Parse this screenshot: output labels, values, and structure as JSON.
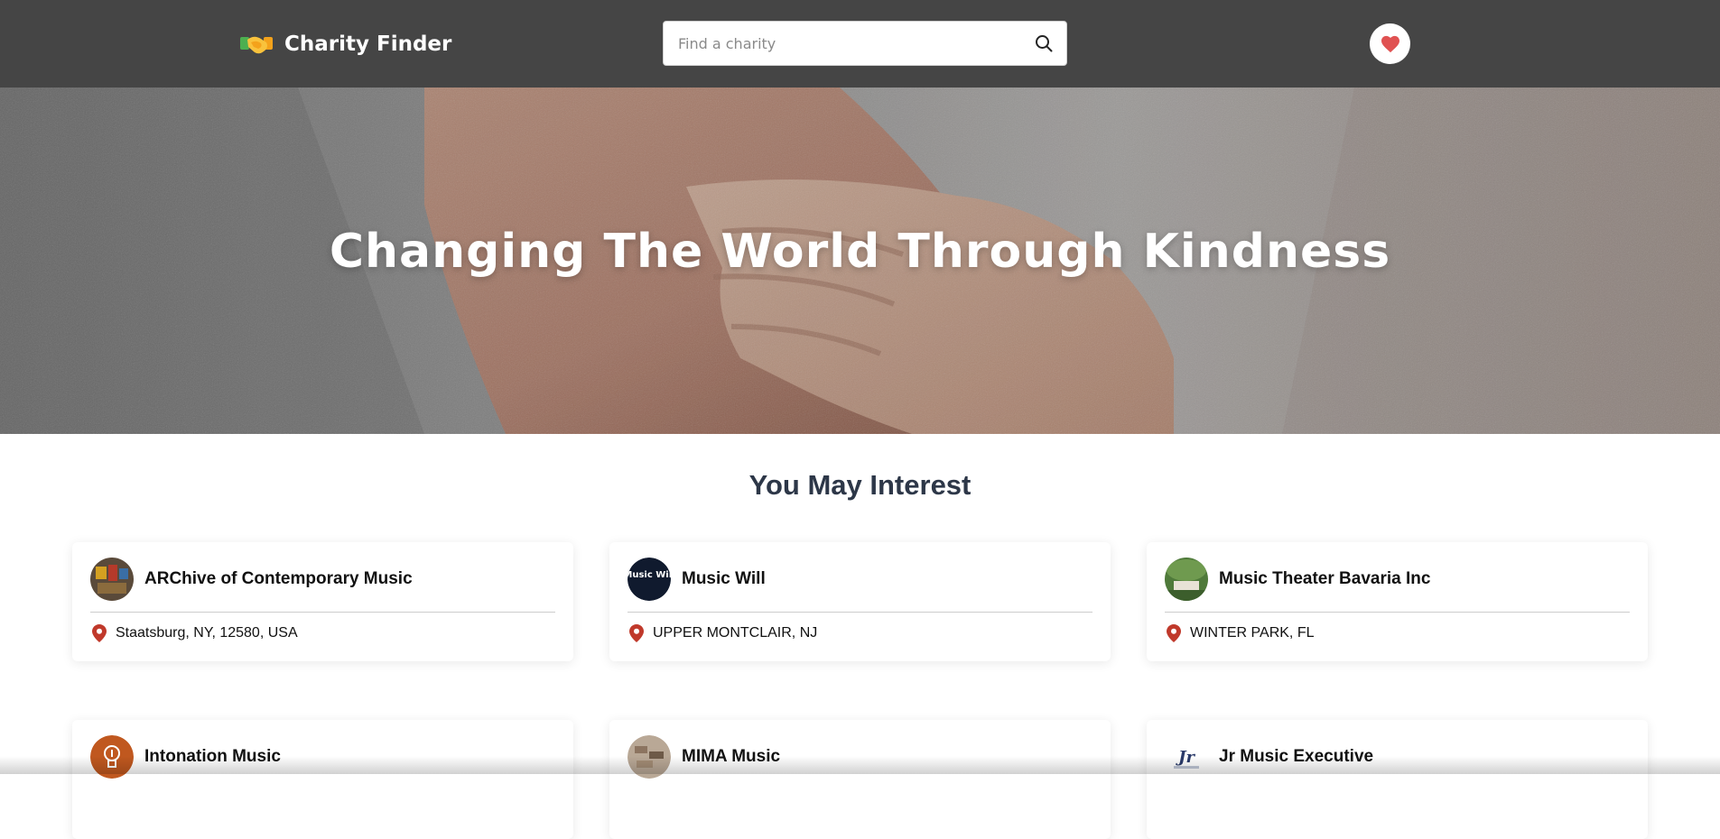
{
  "header": {
    "brand_name": "Charity Finder",
    "logo_icon": "handshake-icon",
    "search": {
      "placeholder": "Find a charity",
      "value": "",
      "icon": "search-icon"
    },
    "favorites_icon": "heart-icon"
  },
  "hero": {
    "title": "Changing The World Through Kindness"
  },
  "section": {
    "title": "You May Interest"
  },
  "charities": [
    {
      "name": "ARChive of Contemporary Music",
      "location": "Staatsburg, NY, 12580, USA",
      "icon": "pin-icon"
    },
    {
      "name": "Music Will",
      "location": "UPPER MONTCLAIR, NJ",
      "icon": "pin-icon"
    },
    {
      "name": "Music Theater Bavaria Inc",
      "location": "WINTER PARK, FL",
      "icon": "pin-icon"
    },
    {
      "name": "Intonation Music"
    },
    {
      "name": "MIMA Music"
    },
    {
      "name": "Jr Music Executive"
    }
  ],
  "logo_texts": {
    "music_will": "Music Will",
    "jr": "Jr"
  },
  "colors": {
    "header_bg": "#454545",
    "heart": "#e05252",
    "pin": "#c0392b",
    "title": "#2d3748"
  }
}
